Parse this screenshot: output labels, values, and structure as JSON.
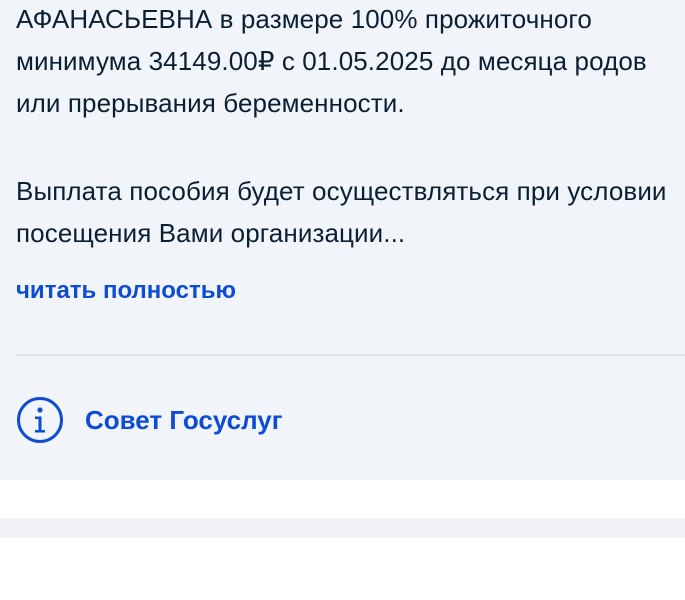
{
  "notice": {
    "paragraph1": "АФАНАСЬЕВНА в размере 100% прожиточного минимума 34149.00₽ с 01.05.2025 до месяца родов или прерывания беременности.",
    "paragraph2": "Выплата пособия будет осуществляться при условии посещения Вами организации...",
    "read_more_label": "читать полностью"
  },
  "tip": {
    "icon": "info-icon",
    "label": "Совет Госуслуг"
  },
  "colors": {
    "card_background": "#f1f5fa",
    "text": "#0b1f33",
    "link": "#0d4cd3",
    "divider": "#dfe4ea"
  }
}
